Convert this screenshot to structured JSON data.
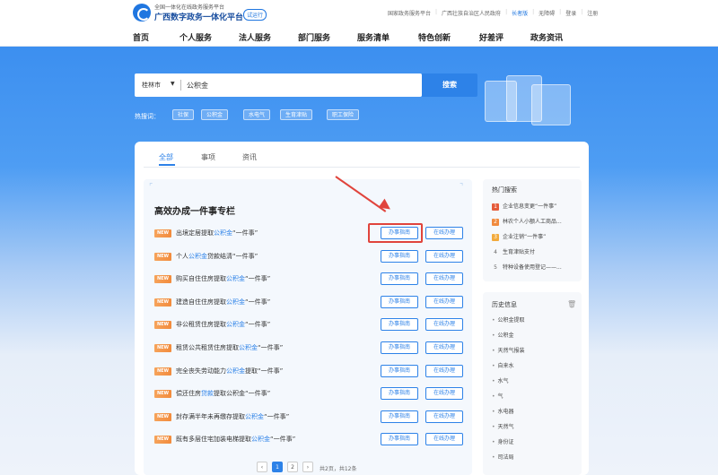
{
  "header": {
    "brand_sub": "全国一体化在线政务服务平台",
    "brand_main": "广西数字政务一体化平台",
    "trial_badge": "试运行",
    "links": [
      "国家政务服务平台",
      "广西壮族自治区人民政府",
      "长者版",
      "无障碍",
      "登录",
      "注册"
    ],
    "login_label": "登录"
  },
  "nav": {
    "items": [
      "首页",
      "个人服务",
      "法人服务",
      "部门服务",
      "服务清单",
      "特色创新",
      "好差评",
      "政务资讯"
    ]
  },
  "search": {
    "city": "桂林市",
    "query": "公积金",
    "button_label": "搜索",
    "hot_label": "热搜词：",
    "hot_tags": [
      "社保",
      "公积金",
      "水电气",
      "生育津贴",
      "职工保险"
    ]
  },
  "tabs": [
    "全部",
    "事项",
    "资讯"
  ],
  "section": {
    "title": "高效办成一件事专栏",
    "badge": "NEW",
    "guide_label": "办事指南",
    "online_label": "在线办理",
    "rows": [
      {
        "before": "出境定居提取",
        "hl": "公积金",
        "after": "“一件事”"
      },
      {
        "before": "个人",
        "hl": "公积金",
        "after": "贷款结清“一件事”"
      },
      {
        "before": "购买自住住房提取",
        "hl": "公积金",
        "after": "“一件事”"
      },
      {
        "before": "建造自住住房提取",
        "hl": "公积金",
        "after": "“一件事”"
      },
      {
        "before": "非公租赁住房提取",
        "hl": "公积金",
        "after": "“一件事”"
      },
      {
        "before": "租赁公共租赁住房提取",
        "hl": "公积金",
        "after": "“一件事”"
      },
      {
        "before": "完全丧失劳动能力",
        "hl": "公积金",
        "after": "提取“一件事”"
      },
      {
        "before": "偿还住房",
        "hl": "贷款",
        "after": "提取公积金“一件事”"
      },
      {
        "before": "封存满半年未再缴存提取",
        "hl": "公积金",
        "after": "“一件事”"
      },
      {
        "before": "既有多层住宅加装电梯提取",
        "hl": "公积金",
        "after": "“一件事”"
      }
    ]
  },
  "pagination": {
    "prev": "‹",
    "pages": [
      "1",
      "2"
    ],
    "next": "›",
    "info": "共2页，共12条"
  },
  "hot_search": {
    "title": "热门搜索",
    "items": [
      {
        "num": "1",
        "text": "企业信息变更“一件事”"
      },
      {
        "num": "2",
        "text": "林农个人小额人工商品..."
      },
      {
        "num": "3",
        "text": "企业注销“一件事”"
      },
      {
        "num": "4",
        "text": "生育津贴支付"
      },
      {
        "num": "5",
        "text": "特种设备使用登记——..."
      }
    ]
  },
  "history": {
    "title": "历史信息",
    "items": [
      "公积金提取",
      "公积金",
      "天然气报装",
      "自来水",
      "水气",
      "气",
      "水电器",
      "天然气",
      "身份证",
      "司法局"
    ]
  },
  "colors": {
    "primary": "#2d82e8",
    "highlight_box": "#e0443c",
    "new_badge": "#f28b3d"
  }
}
